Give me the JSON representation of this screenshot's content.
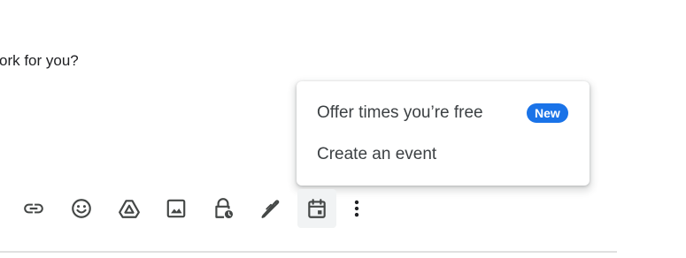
{
  "compose": {
    "body_text": "ork for you?"
  },
  "menu": {
    "items": [
      {
        "label": "Offer times you’re free",
        "badge": "New"
      },
      {
        "label": "Create an event"
      }
    ],
    "badge_color": "#1a73e8"
  },
  "toolbar": {
    "icons": [
      "link-icon",
      "emoji-icon",
      "drive-icon",
      "image-icon",
      "confidential-mode-icon",
      "signature-icon",
      "calendar-icon",
      "more-options-icon"
    ],
    "active": "calendar-icon"
  }
}
